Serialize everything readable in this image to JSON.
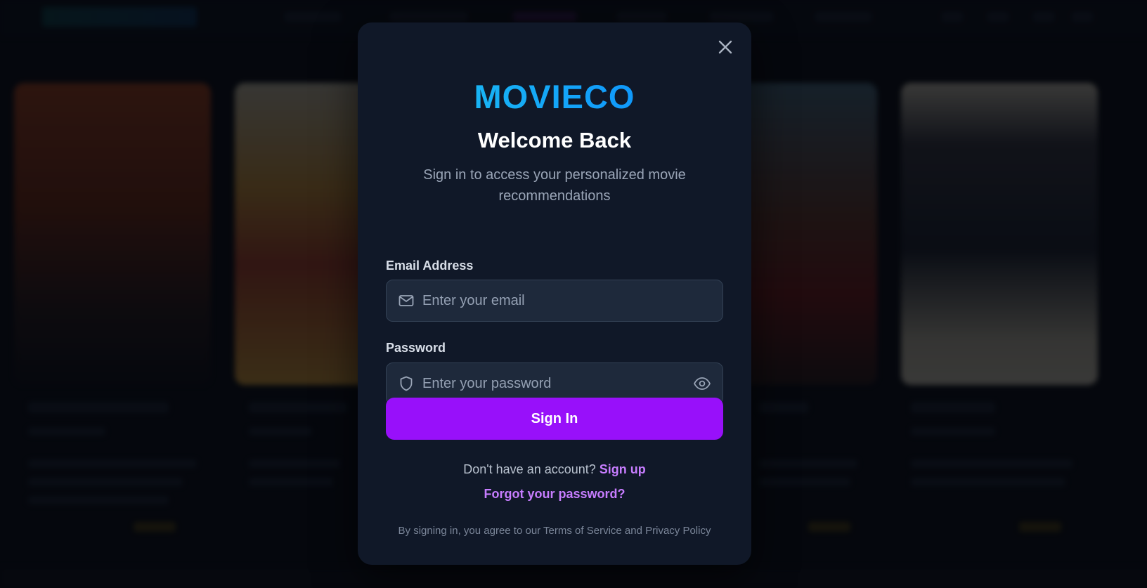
{
  "modal": {
    "close_icon": "close-icon",
    "brand": "MOVIECO",
    "brand_gradient": [
      "#1ec8f0",
      "#0a84ff"
    ],
    "title": "Welcome Back",
    "subtitle": "Sign in to access your personalized movie recommendations",
    "email": {
      "label": "Email Address",
      "placeholder": "Enter your email",
      "value": "",
      "icon": "mail-icon"
    },
    "password": {
      "label": "Password",
      "placeholder": "Enter your password",
      "value": "",
      "icon": "shield-icon",
      "toggle_icon": "eye-icon"
    },
    "signin_label": "Sign In",
    "signup_prompt": "Don't have an account?",
    "signup_link": "Sign up",
    "forgot_link": "Forgot your password?",
    "terms": "By signing in, you agree to our Terms of Service and Privacy Policy"
  },
  "colors": {
    "modal_bg": "#101828",
    "button": "#9810fa",
    "link": "#c77dff",
    "input_bg": "#1e293b"
  }
}
